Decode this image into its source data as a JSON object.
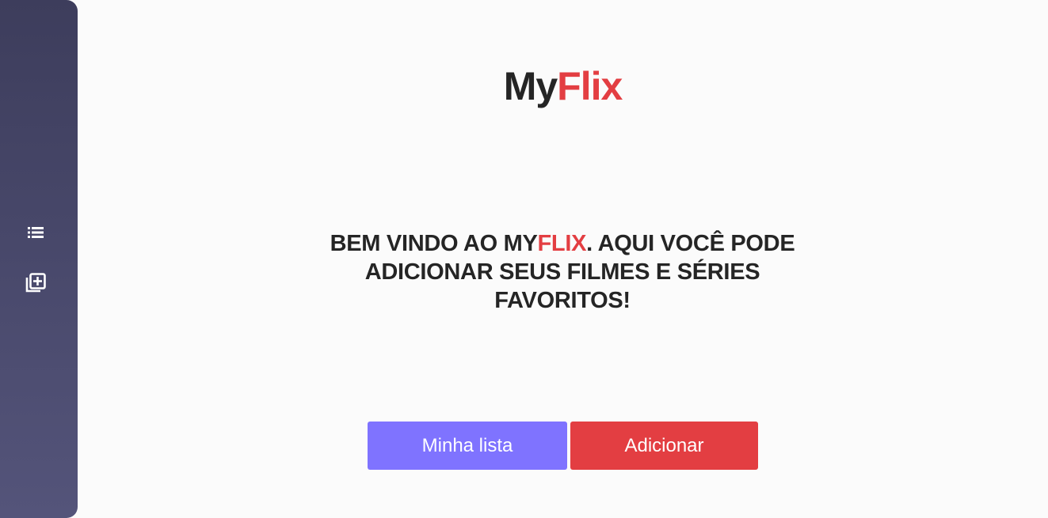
{
  "logo": {
    "part1": "My",
    "part2": "Flix"
  },
  "welcome": {
    "pre": "BEM VINDO AO MY",
    "highlight": "FLIX",
    "post": ". AQUI VOCÊ PODE ADICIONAR SEUS FILMES E SÉRIES FAVORITOS!"
  },
  "buttons": {
    "list": "Minha lista",
    "add": "Adicionar"
  },
  "sidebar": {
    "icons": [
      "list-icon",
      "library-add-icon"
    ]
  },
  "colors": {
    "accent_red": "#e33e42",
    "accent_purple": "#7f73ff",
    "sidebar": "#3d3d5c"
  }
}
